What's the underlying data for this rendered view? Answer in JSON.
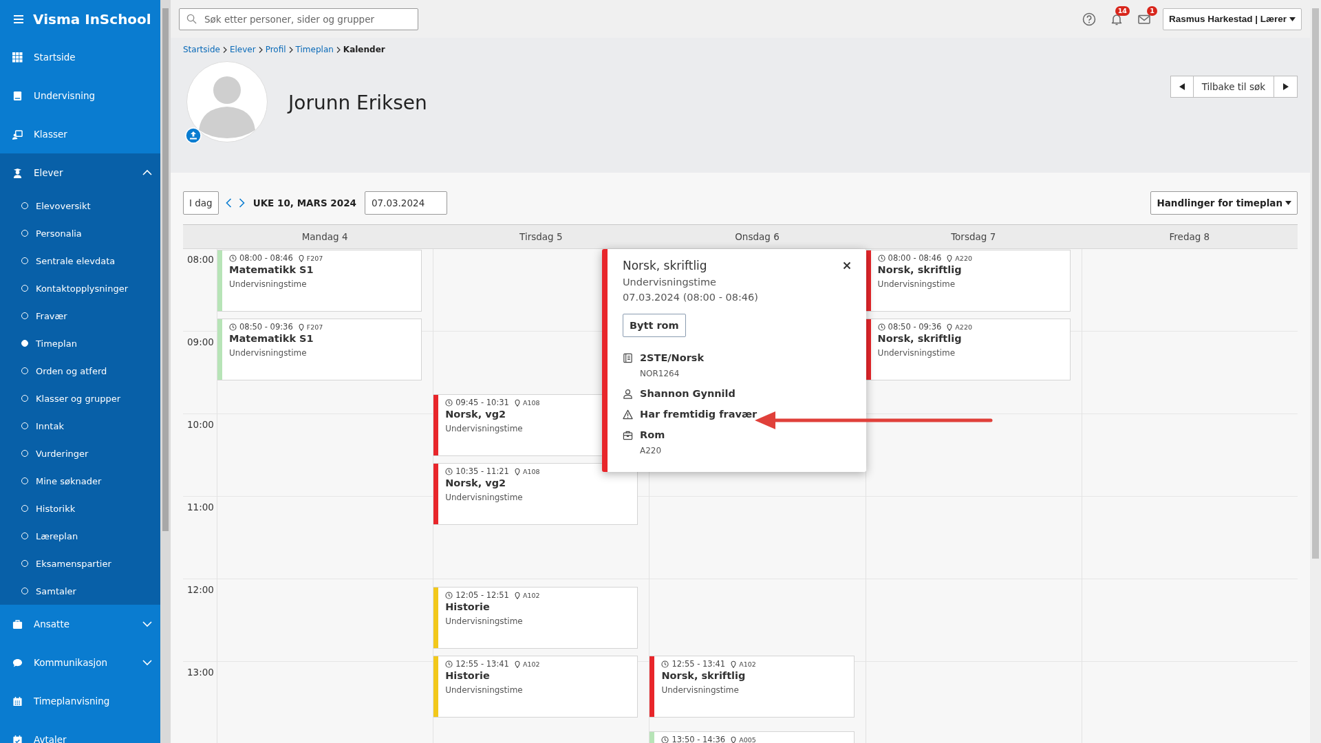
{
  "app": {
    "title": "Visma InSchool"
  },
  "sidebar": {
    "items": [
      {
        "kind": "link",
        "label": "Startside"
      },
      {
        "kind": "link",
        "label": "Undervisning"
      },
      {
        "kind": "link",
        "label": "Klasser"
      },
      {
        "kind": "group",
        "label": "Elever",
        "expanded": true,
        "children": [
          {
            "label": "Elevoversikt",
            "selected": false
          },
          {
            "label": "Personalia",
            "selected": false
          },
          {
            "label": "Sentrale elevdata",
            "selected": false
          },
          {
            "label": "Kontaktopplysninger",
            "selected": false
          },
          {
            "label": "Fravær",
            "selected": false
          },
          {
            "label": "Timeplan",
            "selected": true
          },
          {
            "label": "Orden og atferd",
            "selected": false
          },
          {
            "label": "Klasser og grupper",
            "selected": false
          },
          {
            "label": "Inntak",
            "selected": false
          },
          {
            "label": "Vurderinger",
            "selected": false
          },
          {
            "label": "Mine søknader",
            "selected": false
          },
          {
            "label": "Historikk",
            "selected": false
          },
          {
            "label": "Læreplan",
            "selected": false
          },
          {
            "label": "Eksamenspartier",
            "selected": false
          },
          {
            "label": "Samtaler",
            "selected": false
          }
        ]
      },
      {
        "kind": "group",
        "label": "Ansatte",
        "expanded": false
      },
      {
        "kind": "group",
        "label": "Kommunikasjon",
        "expanded": false
      },
      {
        "kind": "link",
        "label": "Timeplanvisning"
      },
      {
        "kind": "link",
        "label": "Avtaler"
      }
    ]
  },
  "topbar": {
    "search": {
      "placeholder": "Søk etter personer, sider og grupper"
    },
    "notifications": "14",
    "messages": "1",
    "user": "Rasmus Harkestad | Lærer"
  },
  "breadcrumb": [
    "Startside",
    "Elever",
    "Profil",
    "Timeplan",
    "Kalender"
  ],
  "profile": {
    "name": "Jorunn Eriksen",
    "back_button": "Tilbake til søk"
  },
  "calendar": {
    "today_button": "I dag",
    "week": "UKE 10, MARS 2024",
    "date": "07.03.2024",
    "actions_button": "Handlinger for timeplan",
    "hours": [
      "08:00",
      "09:00",
      "10:00",
      "11:00",
      "12:00",
      "13:00"
    ],
    "days": [
      {
        "label": "Mandag 4",
        "events": [
          {
            "time": "08:00 - 08:46",
            "room": "F207",
            "title": "Matematikk S1",
            "type": "Undervisningstime",
            "color": "#b7e4b7"
          },
          {
            "time": "08:50 - 09:36",
            "room": "F207",
            "title": "Matematikk S1",
            "type": "Undervisningstime",
            "color": "#b7e4b7"
          }
        ]
      },
      {
        "label": "Tirsdag 5",
        "events": [
          {
            "time": "09:45 - 10:31",
            "room": "A108",
            "title": "Norsk, vg2",
            "type": "Undervisningstime",
            "color": "#e8262b"
          },
          {
            "time": "10:35 - 11:21",
            "room": "A108",
            "title": "Norsk, vg2",
            "type": "Undervisningstime",
            "color": "#e8262b"
          },
          {
            "time": "12:05 - 12:51",
            "room": "A102",
            "title": "Historie",
            "type": "Undervisningstime",
            "color": "#f2c81b"
          },
          {
            "time": "12:55 - 13:41",
            "room": "A102",
            "title": "Historie",
            "type": "Undervisningstime",
            "color": "#f2c81b"
          }
        ]
      },
      {
        "label": "Onsdag 6",
        "events": [
          {
            "time": "12:55 - 13:41",
            "room": "A102",
            "title": "Norsk, skriftlig",
            "type": "Undervisningstime",
            "color": "#e8262b"
          },
          {
            "time": "13:50 - 14:36",
            "room": "A005",
            "color": "#b7e4b7"
          }
        ]
      },
      {
        "label": "Torsdag 7",
        "events": [
          {
            "time": "08:00 - 08:46",
            "room": "A220",
            "title": "Norsk, skriftlig",
            "type": "Undervisningstime",
            "color": "#e8262b"
          },
          {
            "time": "08:50 - 09:36",
            "room": "A220",
            "title": "Norsk, skriftlig",
            "type": "Undervisningstime",
            "color": "#e8262b"
          }
        ]
      },
      {
        "label": "Fredag 8"
      }
    ]
  },
  "popup": {
    "title": "Norsk, skriftlig",
    "type": "Undervisningstime",
    "when": "07.03.2024 (08:00 - 08:46)",
    "button": "Bytt rom",
    "color": "#e8262b",
    "details": [
      {
        "kind": "course",
        "label": "2STE/Norsk",
        "sub": "NOR1264"
      },
      {
        "kind": "teacher",
        "label": "Shannon Gynnild"
      },
      {
        "kind": "warning",
        "label": "Har fremtidig fravær"
      },
      {
        "kind": "room",
        "label": "Rom",
        "sub": "A220"
      }
    ]
  }
}
